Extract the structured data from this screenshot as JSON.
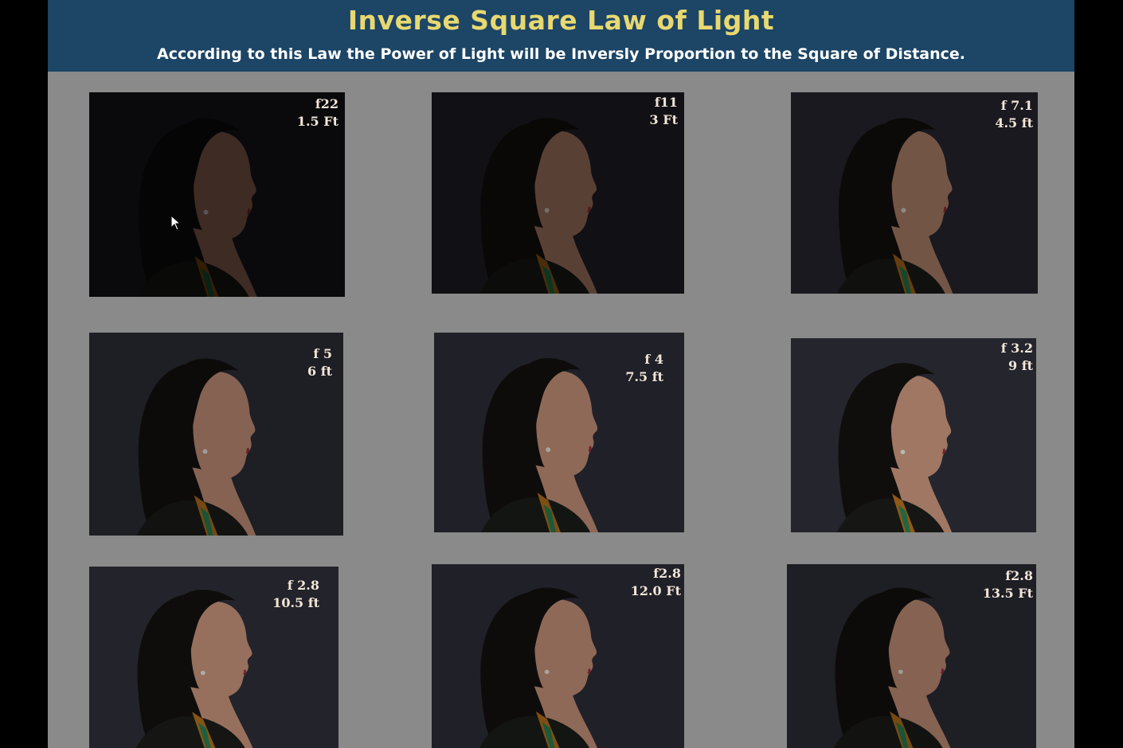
{
  "slide": {
    "title": "Inverse Square Law of Light",
    "subtitle": "According to this Law  the Power of Light will be Inversly Proportion to the Square of Distance."
  },
  "photos": [
    {
      "aperture": "f22",
      "distance": "1.5 Ft",
      "brightness": 0.15
    },
    {
      "aperture": "f11",
      "distance": "3 Ft",
      "brightness": 0.3
    },
    {
      "aperture": "f 7.1",
      "distance": "4.5 ft",
      "brightness": 0.45
    },
    {
      "aperture": "f 5",
      "distance": "6 ft",
      "brightness": 0.55
    },
    {
      "aperture": "f 4",
      "distance": "7.5 ft",
      "brightness": 0.6
    },
    {
      "aperture": "f 3.2",
      "distance": "9 ft",
      "brightness": 0.7
    },
    {
      "aperture": "f 2.8",
      "distance": "10.5 ft",
      "brightness": 0.65
    },
    {
      "aperture": "f2.8",
      "distance": "12.0 Ft",
      "brightness": 0.6
    },
    {
      "aperture": "f2.8",
      "distance": "13.5 Ft",
      "brightness": 0.55
    }
  ],
  "colors": {
    "header_bg": "#1c4566",
    "title": "#e8d870",
    "slide_bg": "#8a8a8a"
  }
}
